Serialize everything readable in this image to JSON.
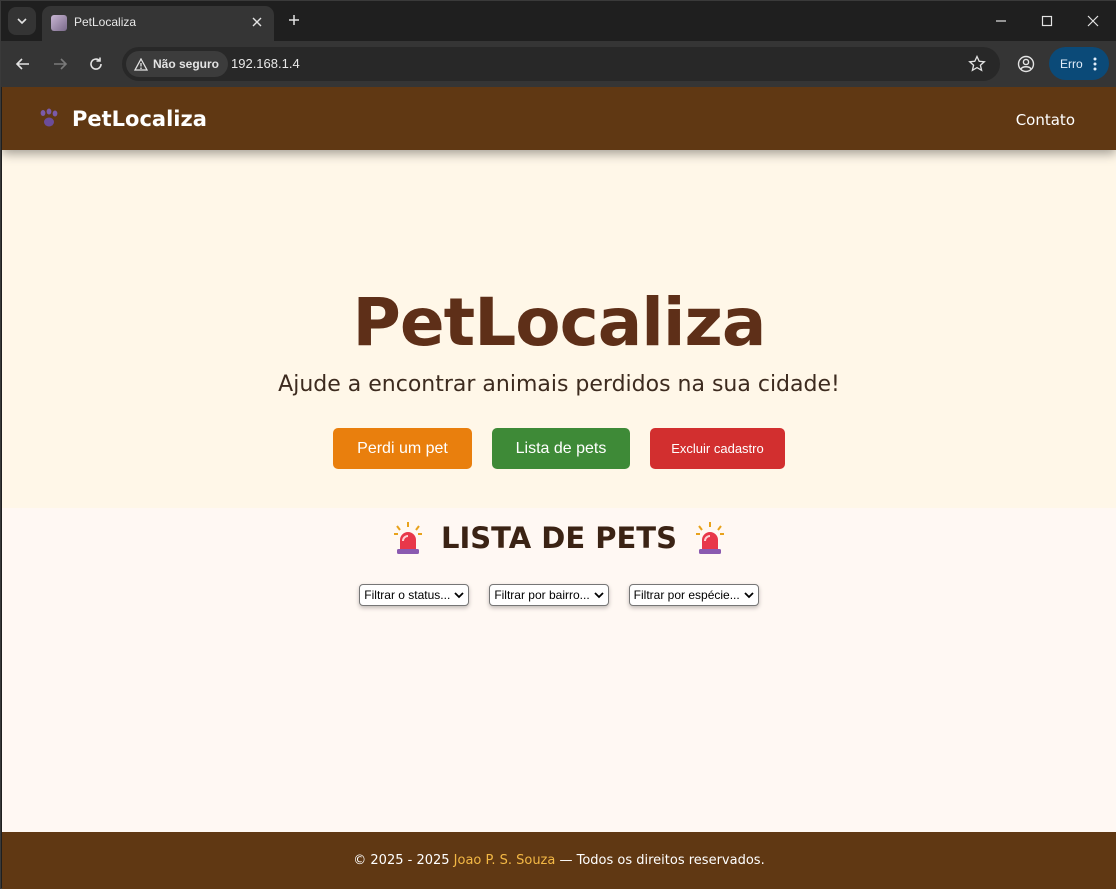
{
  "browser": {
    "tab_title": "PetLocaliza",
    "security_label": "Não seguro",
    "url": "192.168.1.4",
    "profile_status": "Erro"
  },
  "header": {
    "brand": "PetLocaliza",
    "brand_icon": "paw-icon",
    "nav_link": "Contato"
  },
  "hero": {
    "title": "PetLocaliza",
    "subtitle": "Ajude a encontrar animais perdidos na sua cidade!",
    "buttons": {
      "lost_pet": "Perdi um pet",
      "pet_list": "Lista de pets",
      "delete_account": "Excluir cadastro"
    }
  },
  "pet_list": {
    "heading": "LISTA DE PETS",
    "heading_icon": "siren-icon",
    "filters": {
      "status": "Filtrar o status...",
      "neighborhood": "Filtrar por bairro...",
      "species": "Filtrar por espécie..."
    }
  },
  "footer": {
    "prefix": "© 2025 - 2025 ",
    "author": "Joao P. S. Souza",
    "suffix": " — Todos os direitos reservados."
  },
  "colors": {
    "header_bg": "#603813",
    "hero_bg": "#fff7e8",
    "title_color": "#5e2f18",
    "btn_lost": "#e97f0d",
    "btn_list": "#3e8a37",
    "btn_delete": "#d22f2f",
    "footer_author": "#f3b845"
  }
}
